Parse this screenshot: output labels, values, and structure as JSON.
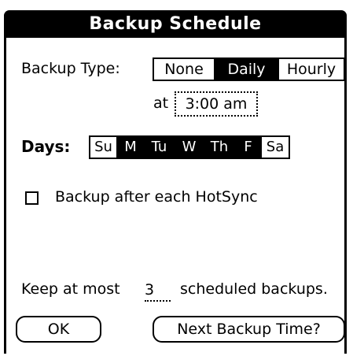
{
  "title": "Backup Schedule",
  "backup_type": {
    "label": "Backup Type:",
    "options": [
      "None",
      "Daily",
      "Hourly"
    ],
    "selected": "Daily"
  },
  "time": {
    "prefix": "at",
    "value": "3:00 am"
  },
  "days": {
    "label": "Days:",
    "items": [
      "Su",
      "M",
      "Tu",
      "W",
      "Th",
      "F",
      "Sa"
    ],
    "selected": [
      "M",
      "Tu",
      "W",
      "Th",
      "F"
    ]
  },
  "hotsync": {
    "label": "Backup after each HotSync",
    "checked": false
  },
  "keep": {
    "prefix": "Keep at most",
    "count": "3",
    "suffix": "scheduled backups."
  },
  "buttons": {
    "ok": "OK",
    "next": "Next Backup Time?"
  }
}
